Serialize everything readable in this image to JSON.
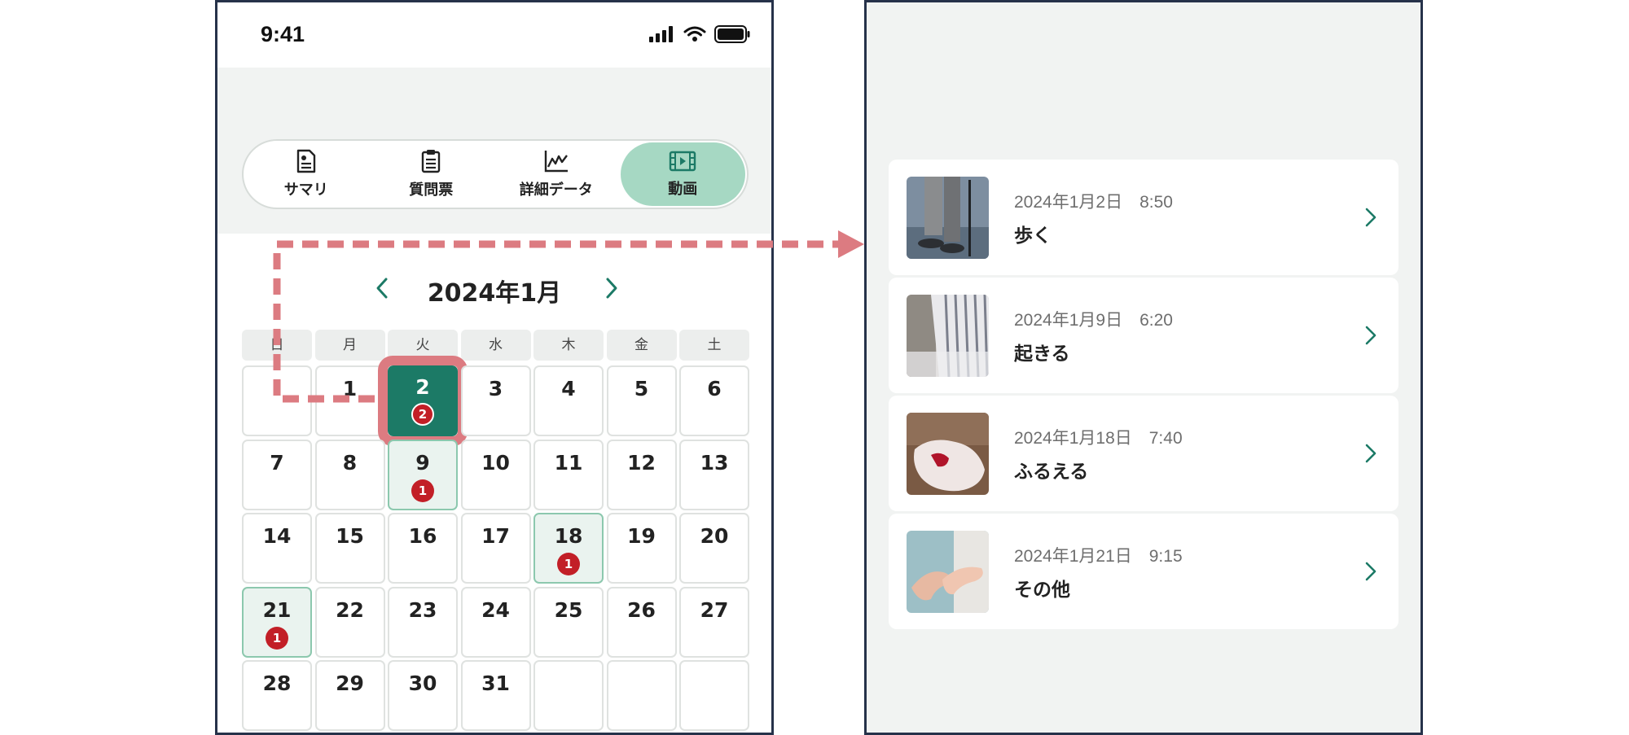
{
  "status_bar": {
    "time": "9:41"
  },
  "tabs": [
    {
      "label": "サマリ",
      "icon": "summary-document-icon",
      "active": false
    },
    {
      "label": "質問票",
      "icon": "clipboard-icon",
      "active": false
    },
    {
      "label": "詳細データ",
      "icon": "line-chart-icon",
      "active": false
    },
    {
      "label": "動画",
      "icon": "film-icon",
      "active": true
    }
  ],
  "calendar": {
    "title": "2024年1月",
    "weekdays": [
      "日",
      "月",
      "火",
      "水",
      "木",
      "金",
      "土"
    ],
    "days": [
      {
        "n": "",
        "c": null
      },
      {
        "n": "1",
        "c": null
      },
      {
        "n": "2",
        "c": "2",
        "selected": true
      },
      {
        "n": "3",
        "c": null
      },
      {
        "n": "4",
        "c": null
      },
      {
        "n": "5",
        "c": null
      },
      {
        "n": "6",
        "c": null
      },
      {
        "n": "7",
        "c": null
      },
      {
        "n": "8",
        "c": null
      },
      {
        "n": "9",
        "c": "1"
      },
      {
        "n": "10",
        "c": null
      },
      {
        "n": "11",
        "c": null
      },
      {
        "n": "12",
        "c": null
      },
      {
        "n": "13",
        "c": null
      },
      {
        "n": "14",
        "c": null
      },
      {
        "n": "15",
        "c": null
      },
      {
        "n": "16",
        "c": null
      },
      {
        "n": "17",
        "c": null
      },
      {
        "n": "18",
        "c": "1"
      },
      {
        "n": "19",
        "c": null
      },
      {
        "n": "20",
        "c": null
      },
      {
        "n": "21",
        "c": "1"
      },
      {
        "n": "22",
        "c": null
      },
      {
        "n": "23",
        "c": null
      },
      {
        "n": "24",
        "c": null
      },
      {
        "n": "25",
        "c": null
      },
      {
        "n": "26",
        "c": null
      },
      {
        "n": "27",
        "c": null
      },
      {
        "n": "28",
        "c": null
      },
      {
        "n": "29",
        "c": null
      },
      {
        "n": "30",
        "c": null
      },
      {
        "n": "31",
        "c": null
      },
      {
        "n": "",
        "c": null
      },
      {
        "n": "",
        "c": null
      },
      {
        "n": "",
        "c": null
      }
    ]
  },
  "videos": [
    {
      "date": "2024年1月2日　8:50",
      "title": "歩く",
      "thumb": "walking-cane-thumbnail"
    },
    {
      "date": "2024年1月9日　6:20",
      "title": "起きる",
      "thumb": "getting-up-thumbnail"
    },
    {
      "date": "2024年1月18日　7:40",
      "title": "ふるえる",
      "thumb": "trembling-hand-thumbnail"
    },
    {
      "date": "2024年1月21日　9:15",
      "title": "その他",
      "thumb": "hands-other-thumbnail"
    }
  ],
  "colors": {
    "accent": "#1c7a66",
    "tab_active": "#a6d8c3",
    "highlight": "#dc7b81",
    "badge": "#c21f27",
    "frame": "#26324a"
  }
}
